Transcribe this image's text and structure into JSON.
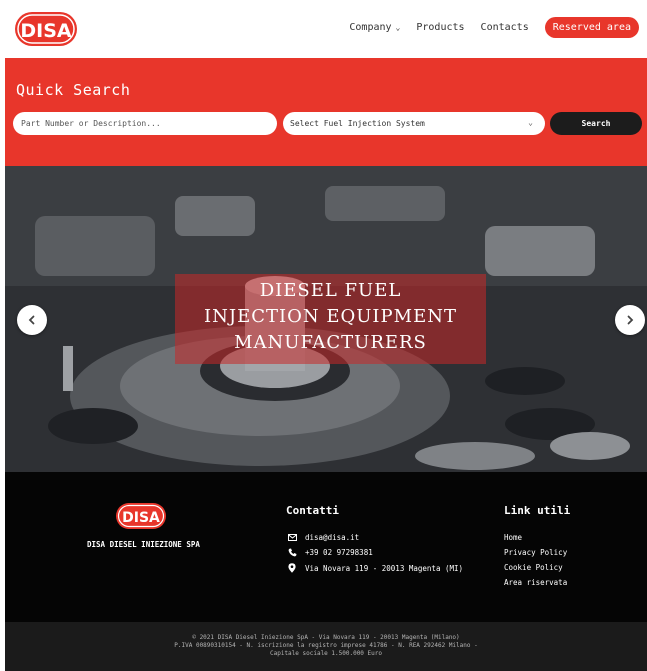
{
  "brand": {
    "logo_text": "DISA",
    "accent_color": "#e8362b"
  },
  "nav": {
    "items": [
      {
        "label": "Company",
        "has_dropdown": true
      },
      {
        "label": "Products"
      },
      {
        "label": "Contacts"
      }
    ],
    "reserved_label": "Reserved area"
  },
  "search": {
    "title": "Quick Search",
    "input_placeholder": "Part Number or Description...",
    "select_value": "Select Fuel Injection System",
    "button_label": "Search"
  },
  "hero": {
    "line1": "DIESEL FUEL",
    "line2": "INJECTION EQUIPMENT",
    "line3": "MANUFACTURERS",
    "prev_icon": "chevron-left-icon",
    "next_icon": "chevron-right-icon"
  },
  "footer": {
    "logo_text": "DISA",
    "company_name": "DISA DIESEL INIEZIONE SPA",
    "contacts_title": "Contatti",
    "contacts": {
      "email": "disa@disa.it",
      "phone": "+39 02 97298381",
      "address": "Via Novara 119 - 20013 Magenta (MI)"
    },
    "links_title": "Link utili",
    "links": [
      "Home",
      "Privacy Policy",
      "Cookie Policy",
      "Area riservata"
    ]
  },
  "legal": {
    "line1": "© 2021 DISA Diesel Iniezione SpA - Via Novara 119 - 20013 Magenta (Milano)",
    "line2": "P.IVA 00890310154 - N. iscrizione la registro imprese 41786 - N. REA 292462 Milano -",
    "line3": "Capitale sociale 1.500.000 Euro"
  }
}
